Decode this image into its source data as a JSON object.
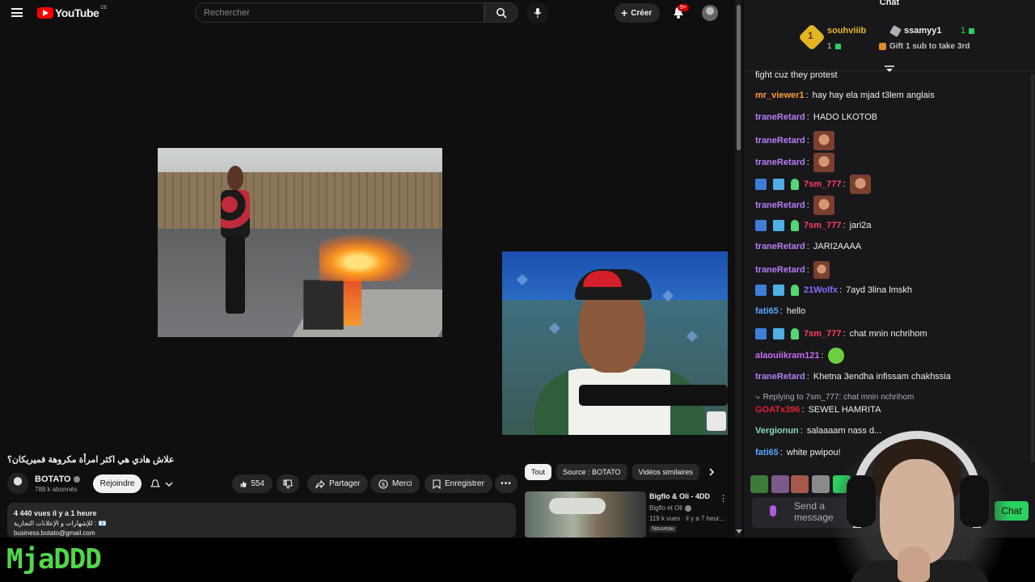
{
  "youtube": {
    "logo_text": "YouTube",
    "logo_country": "DE",
    "search_placeholder": "Rechercher",
    "create_label": "Créer",
    "notification_count": "9+",
    "video_title": "علاش هادي هي اكثر امرأة مكروهة فميريكان؟",
    "channel_name": "BOTATO",
    "channel_subs": "788 k abonnés",
    "join_label": "Rejoindre",
    "like_count": "554",
    "share_label": "Partager",
    "thanks_label": "Merci",
    "save_label": "Enregistrer",
    "description": {
      "stats": "4 440 vues  il y a 1 heure",
      "line2": "للإشهارات و الإعلانات التجارية : 📧",
      "line3": "business.botato@gmail.com"
    },
    "chips": [
      "Tout",
      "Source : BOTATO",
      "Vidéos similaires"
    ],
    "recommendation": {
      "title": "Bigflo & Oli - 4DD",
      "channel": "Bigflo et Oli",
      "meta": "119 k vues · il y a 7 heur...",
      "badge": "Nouveau"
    }
  },
  "chat": {
    "header": "Chat",
    "leaderboard": {
      "first": {
        "rank": "1",
        "name": "souhviiib",
        "count": "1"
      },
      "second": {
        "name": "ssamyy1",
        "count": "1"
      },
      "gift_text": "Gift 1 sub to take 3rd"
    },
    "messages": [
      {
        "user": "",
        "text": "fight cuz they protest",
        "color": "#efeff1"
      },
      {
        "user": "mr_viewer1",
        "text": "hay hay ela mjad t3lem anglais",
        "color": "#ff9b3d"
      },
      {
        "user": "traneRetard",
        "text": "HADO LKOTOB",
        "color": "#b77df5"
      },
      {
        "user": "traneRetard",
        "text": "",
        "color": "#b77df5"
      },
      {
        "user": "traneRetard",
        "text": "",
        "color": "#b77df5"
      },
      {
        "user": "7sm_777",
        "text": "",
        "color": "#ff3f5c"
      },
      {
        "user": "traneRetard",
        "text": "",
        "color": "#b77df5"
      },
      {
        "user": "7sm_777",
        "text": "jari2a",
        "color": "#ff3f5c"
      },
      {
        "user": "traneRetard",
        "text": "JARI2AAAA",
        "color": "#b77df5"
      },
      {
        "user": "traneRetard",
        "text": "",
        "color": "#b77df5"
      },
      {
        "user": "21Wolfx",
        "text": "7ayd 3lina lmskh",
        "color": "#8a6cff"
      },
      {
        "user": "fati65",
        "text": "hello",
        "color": "#5aa8ff"
      },
      {
        "user": "7sm_777",
        "text": "chat mnin nchrihom",
        "color": "#ff3f5c"
      },
      {
        "user": "alaouiikram121",
        "text": "",
        "color": "#c76df2"
      },
      {
        "user": "traneRetard",
        "text": "Khetna 3endha infissam chakhssia",
        "color": "#b77df5"
      },
      {
        "user": "GOATx396",
        "text": "SEWEL HAMRITA",
        "color": "#e5202e"
      },
      {
        "user": "Vergionun",
        "text": "salaaaam nass d...",
        "color": "#8ad7c2"
      },
      {
        "user": "fati65",
        "text": "white pwipou!",
        "color": "#5aa8ff"
      }
    ],
    "reply_text": "Replying to 7sm_777: chat mnin nchrihom",
    "input_placeholder": "Send a message",
    "chat_button": "Chat"
  },
  "overlay": {
    "watermark": "MjaDDD"
  },
  "colors": {
    "accent_green": "#2ad060",
    "youtube_red": "#ff0000"
  }
}
